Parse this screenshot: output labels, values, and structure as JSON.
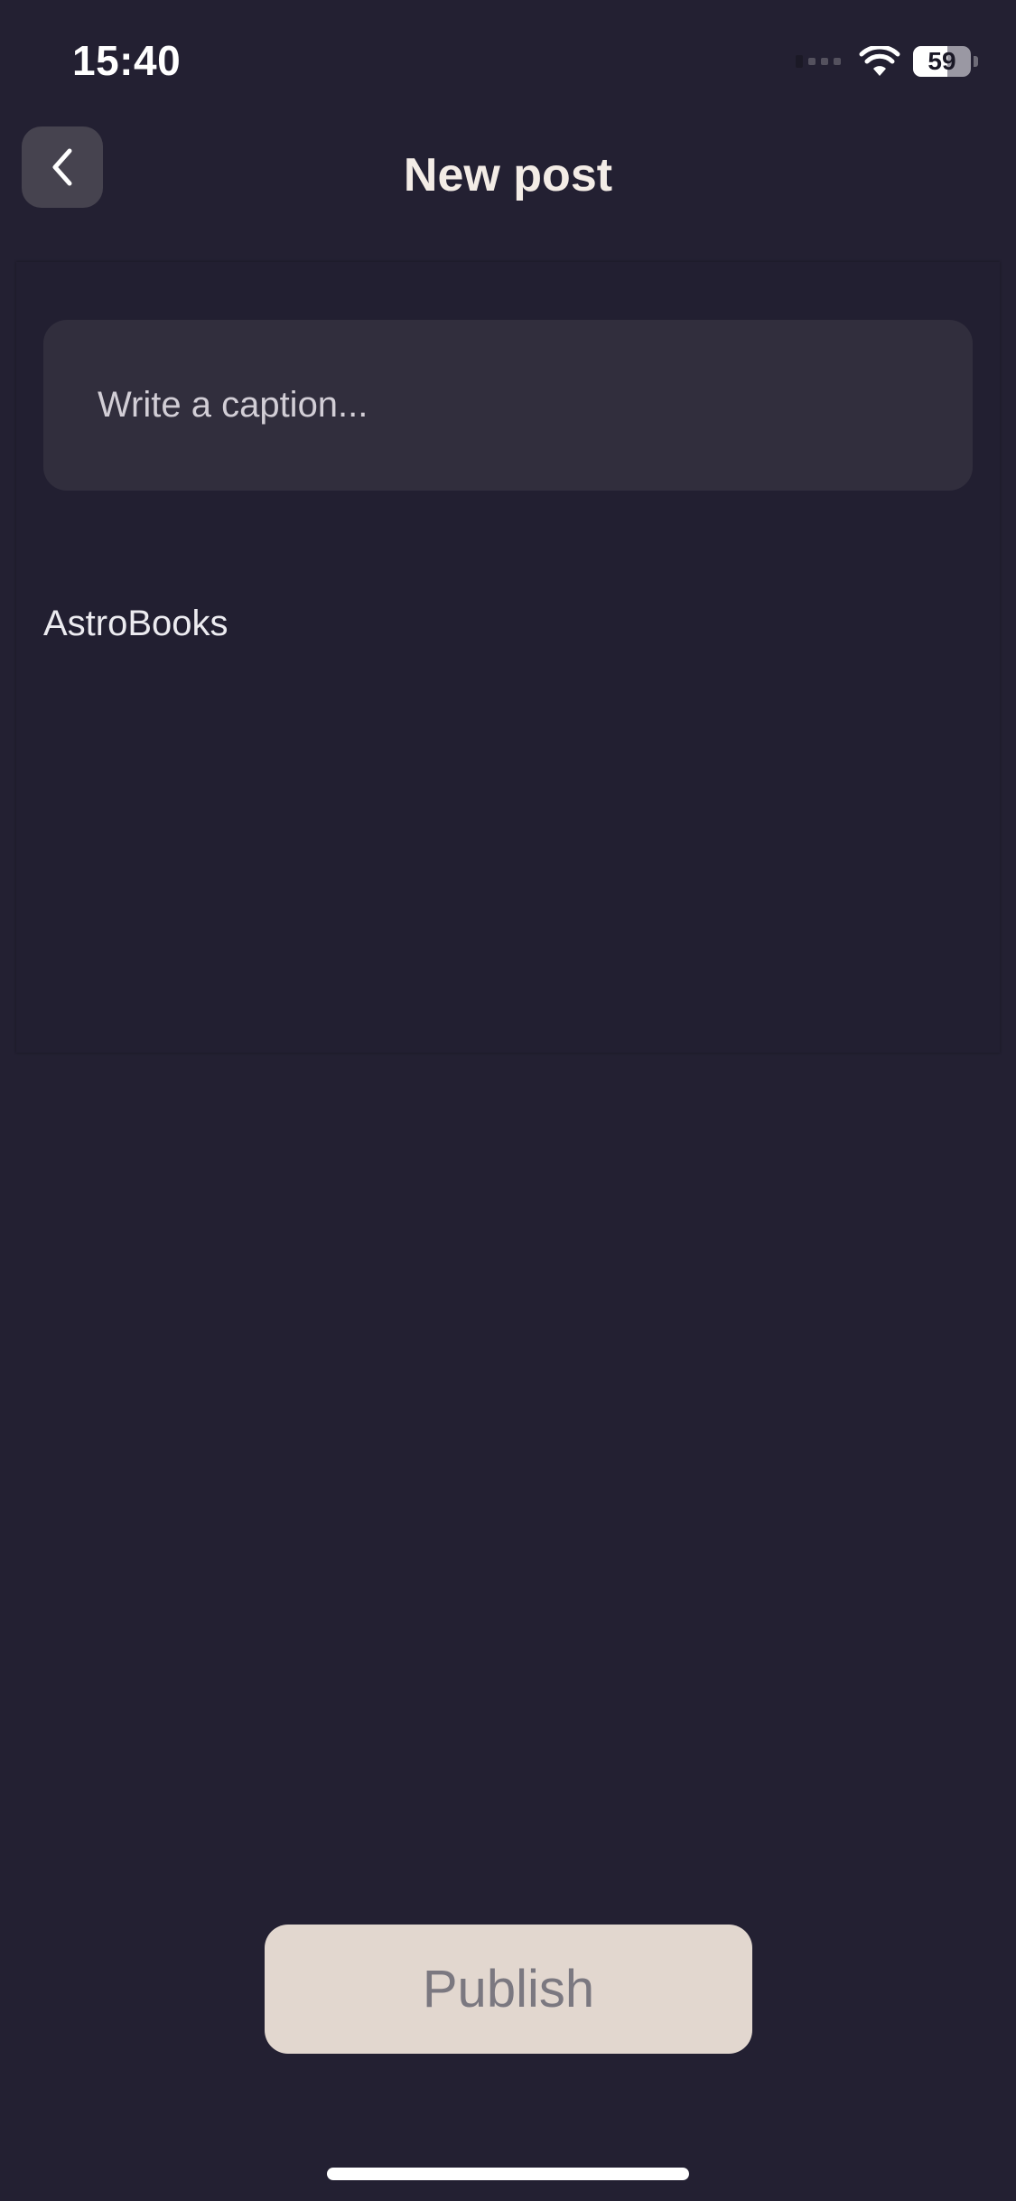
{
  "status_bar": {
    "time": "15:40",
    "battery_level": "59",
    "battery_fraction": 0.59,
    "icons": [
      "signal-icon",
      "wifi-icon",
      "battery-icon"
    ]
  },
  "header": {
    "title": "New post",
    "back_icon": "chevron-left-icon"
  },
  "composer": {
    "caption_placeholder": "Write a caption...",
    "caption_value": "",
    "account_name": "AstroBooks"
  },
  "actions": {
    "publish_label": "Publish"
  },
  "colors": {
    "background": "#232032",
    "input_background": "#312e3d",
    "back_button_background": "#46434f",
    "publish_background": "#e2d7cf",
    "publish_text": "#7b7880",
    "title_text": "#f3ece6"
  }
}
